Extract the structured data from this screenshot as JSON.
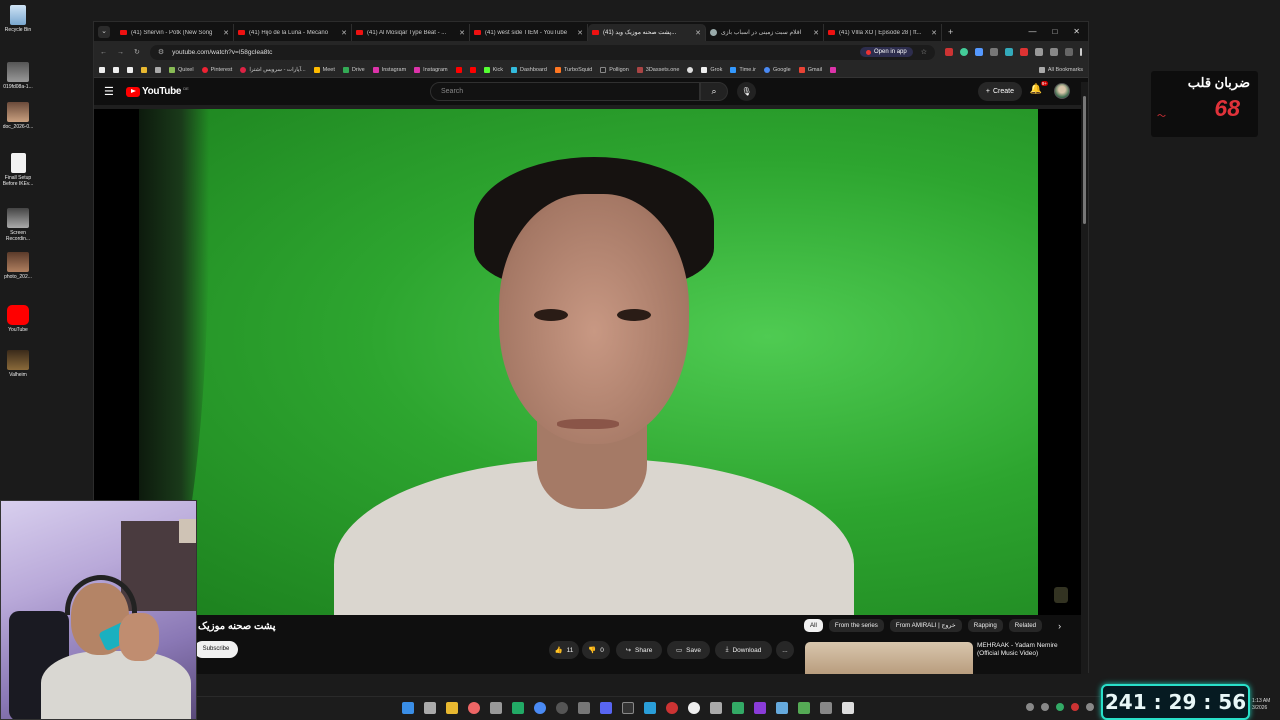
{
  "desktop": {
    "icons": [
      {
        "label": "Recycle Bin",
        "icon": "recycle-bin-icon"
      },
      {
        "label": "019fd08a-1...",
        "icon": "image-file-icon"
      },
      {
        "label": "doc_2026-0...",
        "icon": "image-file-icon"
      },
      {
        "label": "Finall Setup Before IKEv...",
        "icon": "document-icon"
      },
      {
        "label": "Screen Recordin...",
        "icon": "video-file-icon"
      },
      {
        "label": "photo_202...",
        "icon": "image-file-icon"
      },
      {
        "label": "YouTube",
        "icon": "youtube-icon"
      },
      {
        "label": "Valheim",
        "icon": "game-icon"
      }
    ]
  },
  "browser": {
    "tabs": [
      {
        "title": "(41) Shervin - Potk (New Song",
        "icon": "youtube-icon",
        "active": false
      },
      {
        "title": "(41) Hijo de la Luna - Mecano",
        "icon": "youtube-icon",
        "active": false
      },
      {
        "title": "(41) Al Mosiqar Type Beat - ...",
        "icon": "youtube-icon",
        "active": false
      },
      {
        "title": "(41) west side TIEM - YouTube",
        "icon": "youtube-icon",
        "active": false
      },
      {
        "title": "(41) پشت صحنه موزیک وید...",
        "icon": "youtube-icon",
        "active": true
      },
      {
        "title": "اقلام سبت زمینی در اسباب بازی",
        "icon": "web-icon",
        "active": false
      },
      {
        "title": "(41) VIlla XO | Episode 28 | ft...",
        "icon": "youtube-icon",
        "active": false
      }
    ],
    "url": "youtube.com/watch?v=I58gcIea8tc",
    "open_in_app": "Open in app",
    "bookmarks": [
      {
        "label": "Quixel"
      },
      {
        "label": "Pinterest"
      },
      {
        "label": "آپارات - سرویس اشترا..."
      },
      {
        "label": "Meet"
      },
      {
        "label": "Drive"
      },
      {
        "label": "Instagram"
      },
      {
        "label": "Instagram"
      },
      {
        "label": "Kick"
      },
      {
        "label": "Dashboard"
      },
      {
        "label": "TurboSquid"
      },
      {
        "label": "Polligon"
      },
      {
        "label": "3Dassets.one"
      },
      {
        "label": "Grok"
      },
      {
        "label": "Time.ir"
      },
      {
        "label": "Google"
      },
      {
        "label": "Gmail"
      }
    ],
    "all_bookmarks": "All Bookmarks"
  },
  "youtube": {
    "logo_text": "YouTube",
    "logo_country": "DE",
    "search_placeholder": "Search",
    "create_label": "Create",
    "notifications_badge": "9+",
    "video_title": "پشت صحنه موزیک",
    "subscribe_label": "Subscribe",
    "like_count": "11",
    "dislike_count": "0",
    "share_label": "Share",
    "save_label": "Save",
    "download_label": "Download",
    "more_label": "...",
    "chips": [
      "All",
      "From the series",
      "From AMIRALI | خروج",
      "Rapping",
      "Related"
    ],
    "recommendation_title": "MEHRAAK - Yadam Nemire (Official Music Video)"
  },
  "overlay": {
    "heart_rate_label": "ضربان قلب",
    "heart_rate_value": "68",
    "timer": "241 : 29 : 56"
  },
  "taskbar": {
    "clock_time": "1:13 AM",
    "clock_date": "3/2026"
  },
  "colors": {
    "youtube_red": "#ff0000",
    "heart_red": "#e0323a",
    "timer_border": "#29e0c9",
    "green_screen": "#2da52f"
  }
}
